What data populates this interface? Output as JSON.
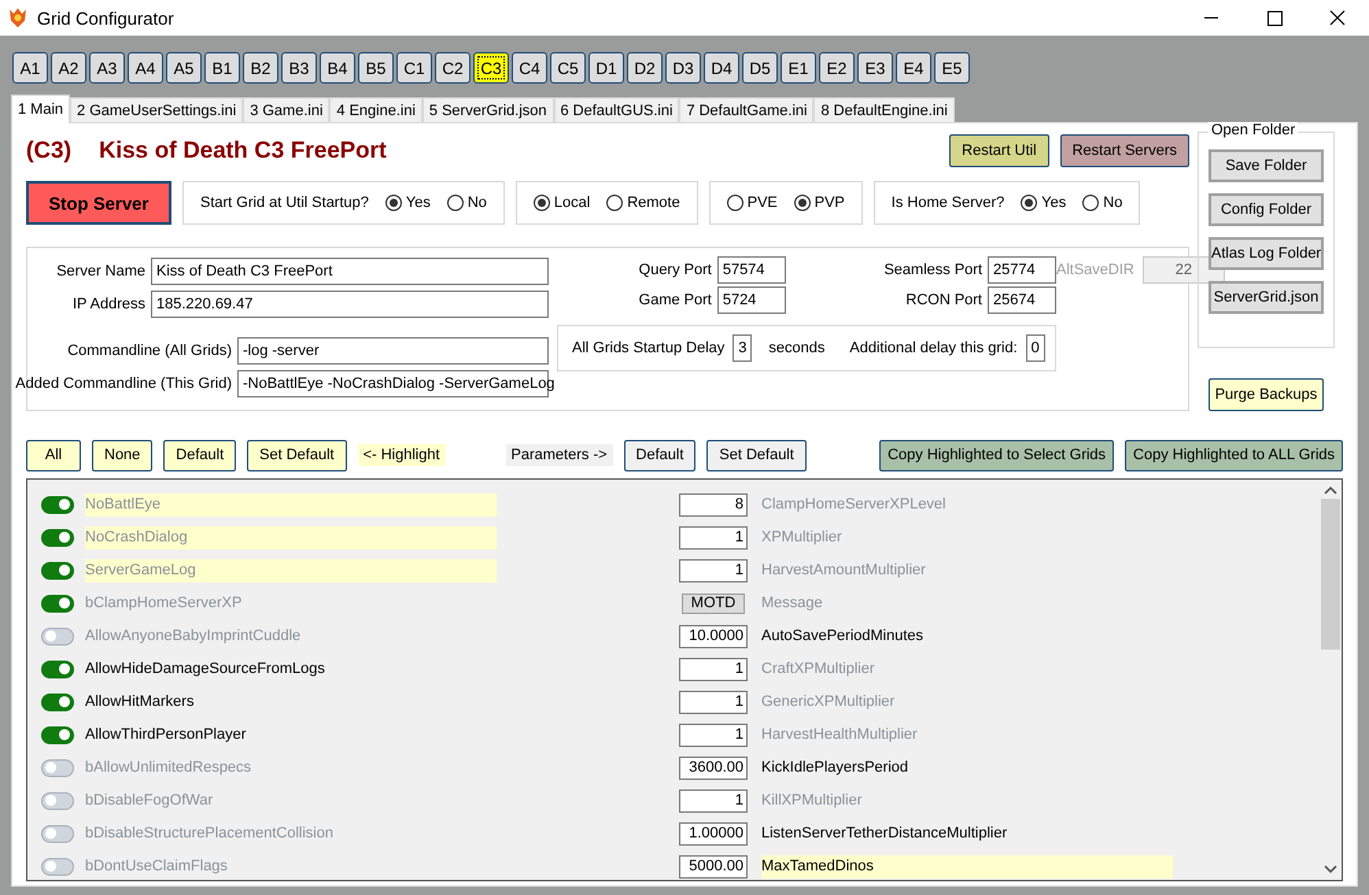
{
  "window": {
    "title": "Grid Configurator"
  },
  "grid_buttons": [
    {
      "label": "A1",
      "selected": false
    },
    {
      "label": "A2",
      "selected": false
    },
    {
      "label": "A3",
      "selected": false
    },
    {
      "label": "A4",
      "selected": false
    },
    {
      "label": "A5",
      "selected": false
    },
    {
      "label": "B1",
      "selected": false
    },
    {
      "label": "B2",
      "selected": false
    },
    {
      "label": "B3",
      "selected": false
    },
    {
      "label": "B4",
      "selected": false
    },
    {
      "label": "B5",
      "selected": false
    },
    {
      "label": "C1",
      "selected": false
    },
    {
      "label": "C2",
      "selected": false
    },
    {
      "label": "C3",
      "selected": true
    },
    {
      "label": "C4",
      "selected": false
    },
    {
      "label": "C5",
      "selected": false
    },
    {
      "label": "D1",
      "selected": false
    },
    {
      "label": "D2",
      "selected": false
    },
    {
      "label": "D3",
      "selected": false
    },
    {
      "label": "D4",
      "selected": false
    },
    {
      "label": "D5",
      "selected": false
    },
    {
      "label": "E1",
      "selected": false
    },
    {
      "label": "E2",
      "selected": false
    },
    {
      "label": "E3",
      "selected": false
    },
    {
      "label": "E4",
      "selected": false
    },
    {
      "label": "E5",
      "selected": false
    }
  ],
  "tabs": [
    {
      "label": "1 Main",
      "selected": true
    },
    {
      "label": "2 GameUserSettings.ini",
      "selected": false
    },
    {
      "label": "3 Game.ini",
      "selected": false
    },
    {
      "label": "4 Engine.ini",
      "selected": false
    },
    {
      "label": "5 ServerGrid.json",
      "selected": false
    },
    {
      "label": "6 DefaultGUS.ini",
      "selected": false
    },
    {
      "label": "7 DefaultGame.ini",
      "selected": false
    },
    {
      "label": "8 DefaultEngine.ini",
      "selected": false
    }
  ],
  "header": {
    "grid_id": "(C3)",
    "server_title": "Kiss of Death C3 FreePort"
  },
  "action_buttons": [
    {
      "label": "Restart Util",
      "color": "#d6d68a"
    },
    {
      "label": "Restart Servers",
      "color": "#c0a0a0"
    }
  ],
  "stop_button": "Stop Server",
  "option_groups": [
    {
      "label": "Start Grid at Util Startup?",
      "options": [
        {
          "label": "Yes",
          "selected": true
        },
        {
          "label": "No",
          "selected": false
        }
      ]
    },
    {
      "options": [
        {
          "label": "Local",
          "selected": true
        },
        {
          "label": "Remote",
          "selected": false
        }
      ]
    },
    {
      "options": [
        {
          "label": "PVE",
          "selected": false
        },
        {
          "label": "PVP",
          "selected": true
        }
      ]
    },
    {
      "label": "Is Home Server?",
      "options": [
        {
          "label": "Yes",
          "selected": true
        },
        {
          "label": "No",
          "selected": false
        }
      ]
    }
  ],
  "server_fields": [
    {
      "label": "Server Name",
      "value": "Kiss of Death C3 FreePort"
    },
    {
      "label": "IP Address",
      "value": "185.220.69.47"
    }
  ],
  "commandline_fields": [
    {
      "label": "Commandline (All Grids)",
      "value": "-log -server"
    },
    {
      "label": "Added Commandline (This Grid)",
      "value": "-NoBattlEye -NoCrashDialog -ServerGameLog"
    }
  ],
  "ports": [
    {
      "label": "Query Port",
      "value": "57574"
    },
    {
      "label": "Seamless Port",
      "value": "25774"
    },
    {
      "label": "Game Port",
      "value": "5724"
    },
    {
      "label": "RCON Port",
      "value": "25674"
    }
  ],
  "alt_save_dir": {
    "label": "AltSaveDIR",
    "value": "22",
    "disabled": true
  },
  "delay": {
    "label": "All Grids Startup Delay",
    "value": "3",
    "unit": "seconds",
    "extra_label": "Additional delay this grid:",
    "extra_value": "0"
  },
  "open_folder": {
    "title": "Open Folder",
    "buttons": [
      "Save Folder",
      "Config Folder",
      "Atlas Log Folder",
      "ServerGrid.json"
    ]
  },
  "purge_button": "Purge Backups",
  "highlight_bar": {
    "buttons": [
      "All",
      "None",
      "Default",
      "Set Default"
    ],
    "note": "<- Highlight"
  },
  "parameters_bar": {
    "label": "Parameters ->",
    "buttons": [
      "Default",
      "Set Default"
    ]
  },
  "copy_buttons": [
    "Copy Highlighted to Select Grids",
    "Copy Highlighted to ALL Grids"
  ],
  "switches": [
    {
      "label": "NoBattlEye",
      "on": true,
      "highlighted": true,
      "modified": false
    },
    {
      "label": "NoCrashDialog",
      "on": true,
      "highlighted": true,
      "modified": false
    },
    {
      "label": "ServerGameLog",
      "on": true,
      "highlighted": true,
      "modified": false
    },
    {
      "label": "bClampHomeServerXP",
      "on": true,
      "highlighted": false,
      "modified": false
    },
    {
      "label": "AllowAnyoneBabyImprintCuddle",
      "on": false,
      "highlighted": false,
      "modified": false
    },
    {
      "label": "AllowHideDamageSourceFromLogs",
      "on": true,
      "highlighted": false,
      "modified": true
    },
    {
      "label": "AllowHitMarkers",
      "on": true,
      "highlighted": false,
      "modified": true
    },
    {
      "label": "AllowThirdPersonPlayer",
      "on": true,
      "highlighted": false,
      "modified": true
    },
    {
      "label": "bAllowUnlimitedRespecs",
      "on": false,
      "highlighted": false,
      "modified": false
    },
    {
      "label": "bDisableFogOfWar",
      "on": false,
      "highlighted": false,
      "modified": false
    },
    {
      "label": "bDisableStructurePlacementCollision",
      "on": false,
      "highlighted": false,
      "modified": false
    },
    {
      "label": "bDontUseClaimFlags",
      "on": false,
      "highlighted": false,
      "modified": false
    }
  ],
  "parameters": [
    {
      "kind": "number",
      "value": "8",
      "label": "ClampHomeServerXPLevel",
      "highlighted": false,
      "modified": false
    },
    {
      "kind": "number",
      "value": "1",
      "label": "XPMultiplier",
      "highlighted": false,
      "modified": false
    },
    {
      "kind": "number",
      "value": "1",
      "label": "HarvestAmountMultiplier",
      "highlighted": false,
      "modified": false
    },
    {
      "kind": "button",
      "value": "MOTD",
      "label": "Message",
      "highlighted": false,
      "modified": false
    },
    {
      "kind": "number",
      "value": "10.0000",
      "label": "AutoSavePeriodMinutes",
      "highlighted": false,
      "modified": true
    },
    {
      "kind": "number",
      "value": "1",
      "label": "CraftXPMultiplier",
      "highlighted": false,
      "modified": false
    },
    {
      "kind": "number",
      "value": "1",
      "label": "GenericXPMultiplier",
      "highlighted": false,
      "modified": false
    },
    {
      "kind": "number",
      "value": "1",
      "label": "HarvestHealthMultiplier",
      "highlighted": false,
      "modified": false
    },
    {
      "kind": "number",
      "value": "3600.00",
      "label": "KickIdlePlayersPeriod",
      "highlighted": false,
      "modified": true
    },
    {
      "kind": "number",
      "value": "1",
      "label": "KillXPMultiplier",
      "highlighted": false,
      "modified": false
    },
    {
      "kind": "number",
      "value": "1.00000",
      "label": "ListenServerTetherDistanceMultiplier",
      "highlighted": false,
      "modified": true
    },
    {
      "kind": "number",
      "value": "5000.00",
      "label": "MaxTamedDinos",
      "highlighted": true,
      "modified": true
    }
  ]
}
